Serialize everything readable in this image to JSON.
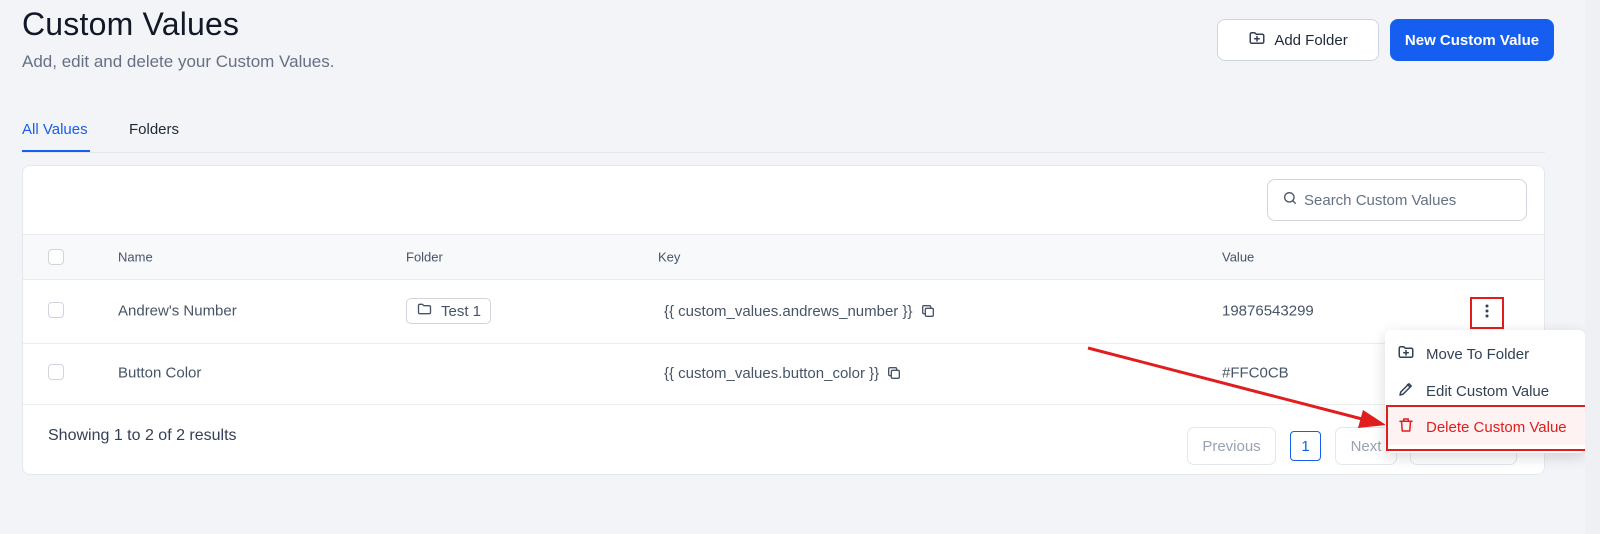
{
  "header": {
    "title": "Custom Values",
    "subtitle": "Add, edit and delete your Custom Values.",
    "add_folder_label": "Add Folder",
    "new_value_label": "New Custom Value"
  },
  "tabs": [
    {
      "label": "All Values",
      "active": true
    },
    {
      "label": "Folders",
      "active": false
    }
  ],
  "search": {
    "placeholder": "Search Custom Values"
  },
  "table": {
    "columns": [
      "Name",
      "Folder",
      "Key",
      "Value"
    ],
    "rows": [
      {
        "name": "Andrew's Number",
        "folder": "Test 1",
        "key": "{{ custom_values.andrews_number }}",
        "value": "19876543299"
      },
      {
        "name": "Button Color",
        "folder": "",
        "key": "{{ custom_values.button_color }}",
        "value": "#FFC0CB"
      }
    ]
  },
  "footer": {
    "showing": "Showing 1 to 2 of 2 results",
    "previous": "Previous",
    "page": "1",
    "next": "Next"
  },
  "row_menu": {
    "items": [
      {
        "label": "Move To Folder",
        "icon": "folder-move-icon"
      },
      {
        "label": "Edit Custom Value",
        "icon": "pencil-icon"
      },
      {
        "label": "Delete Custom Value",
        "icon": "trash-icon"
      }
    ]
  },
  "colors": {
    "primary": "#155eef",
    "annotation": "#e11d1d"
  }
}
